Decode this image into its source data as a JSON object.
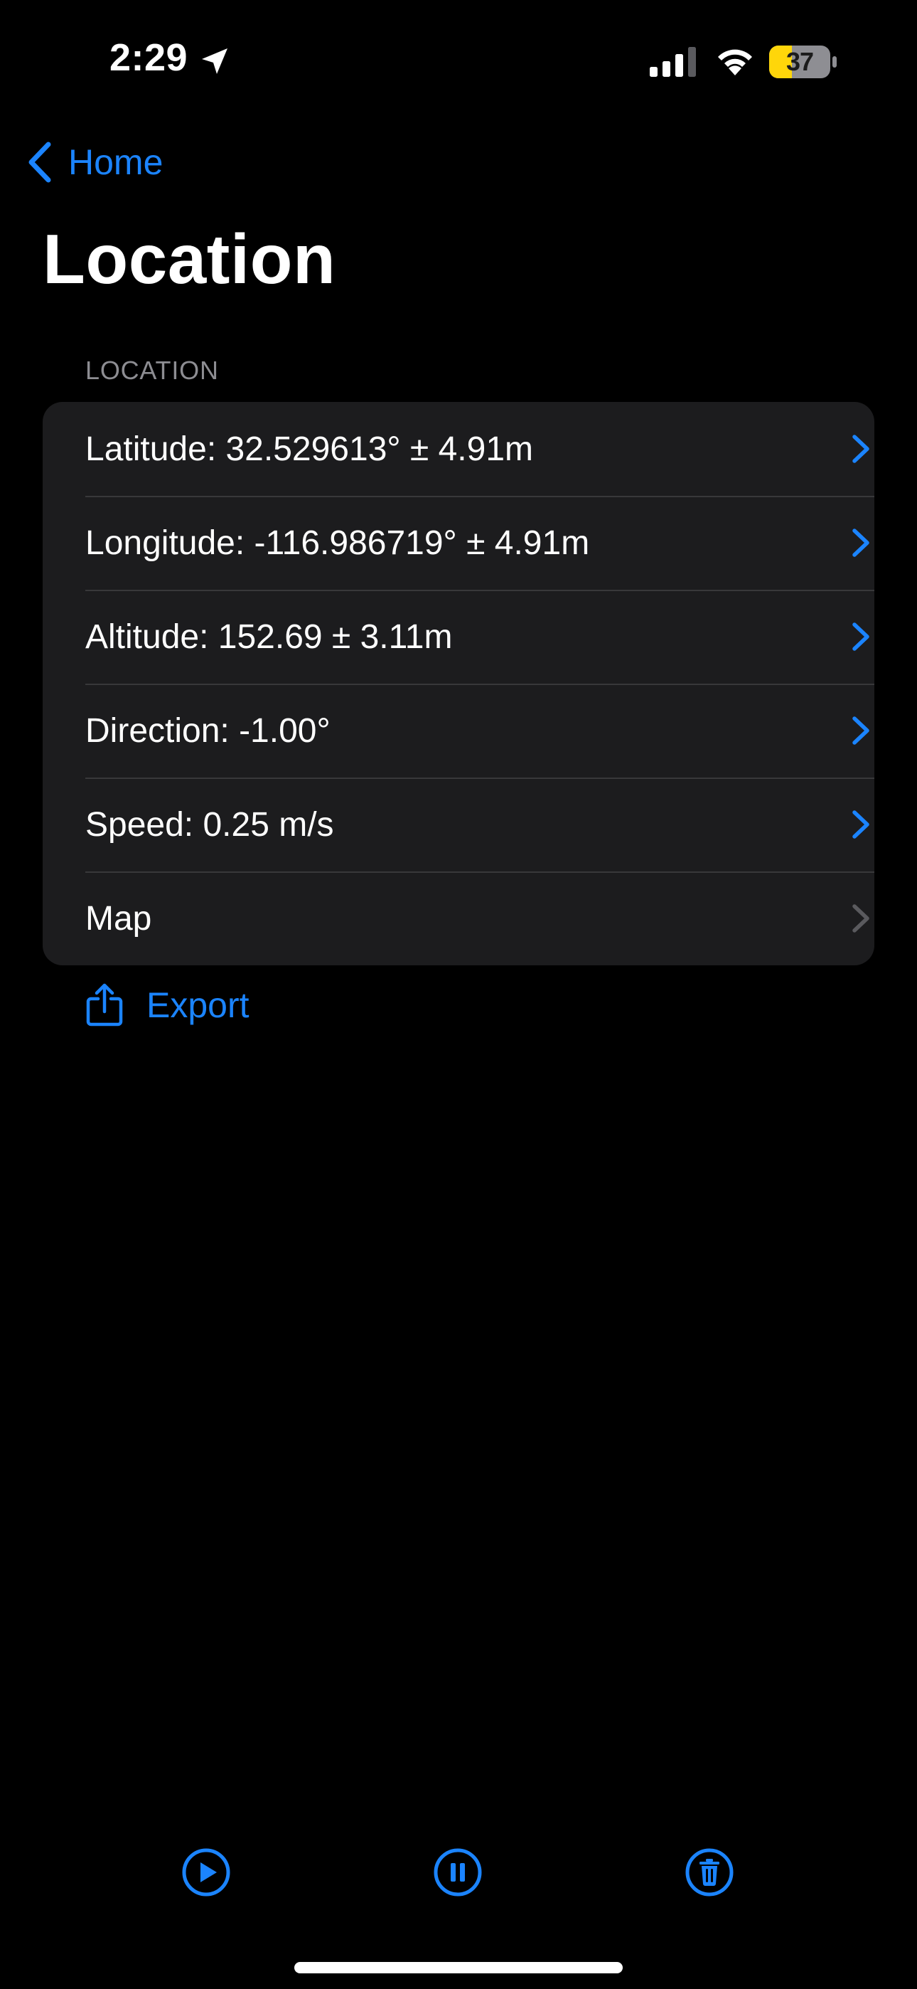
{
  "status_bar": {
    "time": "2:29",
    "battery_level": "37",
    "icons": [
      "location-arrow-icon",
      "cellular-signal-icon",
      "wifi-icon",
      "battery-icon"
    ]
  },
  "nav": {
    "back_label": "Home",
    "back_icon": "chevron-left-icon",
    "title": "Location"
  },
  "section": {
    "header": "LOCATION",
    "rows": [
      {
        "label": "Latitude: 32.529613° ± 4.91m",
        "chevron_color": "#1b84ff"
      },
      {
        "label": "Longitude: -116.986719° ± 4.91m",
        "chevron_color": "#1b84ff"
      },
      {
        "label": "Altitude: 152.69 ± 3.11m",
        "chevron_color": "#1b84ff"
      },
      {
        "label": "Direction: -1.00°",
        "chevron_color": "#1b84ff"
      },
      {
        "label": "Speed: 0.25 m/s",
        "chevron_color": "#1b84ff"
      },
      {
        "label": "Map",
        "chevron_color": "#5a5a5e"
      }
    ]
  },
  "export": {
    "label": "Export",
    "icon": "share-icon"
  },
  "toolbar": {
    "buttons": [
      "play-icon",
      "pause-icon",
      "trash-icon"
    ]
  },
  "colors": {
    "accent": "#1b84ff",
    "background": "#000000",
    "card": "#1c1c1e",
    "secondary_text": "#8d8d92",
    "battery_fill": "#ffd60a"
  }
}
